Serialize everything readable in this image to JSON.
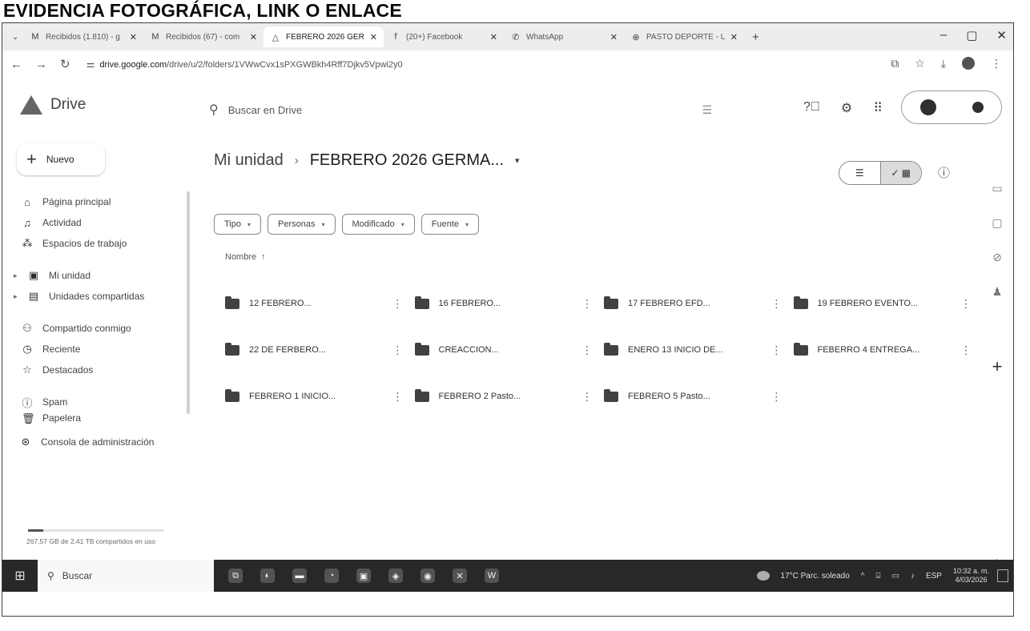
{
  "document_title": "EVIDENCIA FOTOGRÁFICA, LINK O ENLACE",
  "browser": {
    "tabs": [
      {
        "label": "Recibidos (1.810) - g",
        "icon": "gmail-icon",
        "glyph": "M",
        "active": false
      },
      {
        "label": "Recibidos (67) - com",
        "icon": "gmail-icon",
        "glyph": "M",
        "active": false
      },
      {
        "label": "FEBRERO 2026 GER",
        "icon": "drive-icon",
        "glyph": "△",
        "active": true
      },
      {
        "label": "(20+) Facebook",
        "icon": "facebook-icon",
        "glyph": "f",
        "active": false
      },
      {
        "label": "WhatsApp",
        "icon": "whatsapp-icon",
        "glyph": "✆",
        "active": false
      },
      {
        "label": "PASTO DEPORTE - L",
        "icon": "globe-icon",
        "glyph": "⊕",
        "active": false
      }
    ],
    "url_domain": "drive.google.com",
    "url_path": "/drive/u/2/folders/1VWwCvx1sPXGWBkh4Rff7Djkv5Vpwi2y0"
  },
  "drive": {
    "app_name": "Drive",
    "search_placeholder": "Buscar en Drive",
    "new_label": "Nuevo",
    "sidebar": {
      "home": "Página principal",
      "activity": "Actividad",
      "workspaces": "Espacios de trabajo",
      "my_drive": "Mi unidad",
      "shared_drives": "Unidades compartidas",
      "shared_with_me": "Compartido conmigo",
      "recent": "Reciente",
      "starred": "Destacados",
      "spam": "Spam",
      "trash": "Papelera",
      "admin": "Consola de administración"
    },
    "storage": {
      "text": "267,57 GB de 2,41 TB compartidos en uso",
      "fraction": 0.11
    },
    "breadcrumb": {
      "root": "Mi unidad",
      "current": "FEBRERO 2026 GERMA..."
    },
    "filters": [
      "Tipo",
      "Personas",
      "Modificado",
      "Fuente"
    ],
    "sort_label": "Nombre",
    "folders": [
      "12 FEBRERO...",
      "16 FEBRERO...",
      "17 FEBRERO EFD...",
      "19 FEBRERO EVENTO...",
      "22 DE FERBERO...",
      "CREACCION...",
      "ENERO 13 INICIO DE...",
      "FEBERRO 4 ENTREGA...",
      "FEBRERO 1 INICIO...",
      "FEBRERO 2 Pasto...",
      "FEBRERO 5 Pasto..."
    ]
  },
  "taskbar": {
    "search_label": "Buscar",
    "weather": "17°C  Parc. soleado",
    "language": "ESP",
    "time": "10:32 a. m.",
    "date": "4/03/2026"
  }
}
